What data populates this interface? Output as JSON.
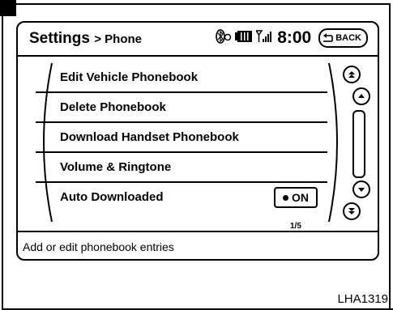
{
  "header": {
    "title": "Settings",
    "separator": ">",
    "subtitle": "Phone",
    "clock": "8:00",
    "back_label": "BACK"
  },
  "status_icons": [
    "bluetooth-icon",
    "battery-icon",
    "signal-icon"
  ],
  "menu": {
    "items": [
      {
        "label": "Edit Vehicle Phonebook"
      },
      {
        "label": "Delete Phonebook"
      },
      {
        "label": "Download Handset Phonebook"
      },
      {
        "label": "Volume & Ringtone"
      },
      {
        "label": "Auto Downloaded",
        "toggle": "ON"
      }
    ],
    "page_indicator": "1/5"
  },
  "help_text": "Add or edit phonebook entries",
  "figure_label": "LHA1319"
}
